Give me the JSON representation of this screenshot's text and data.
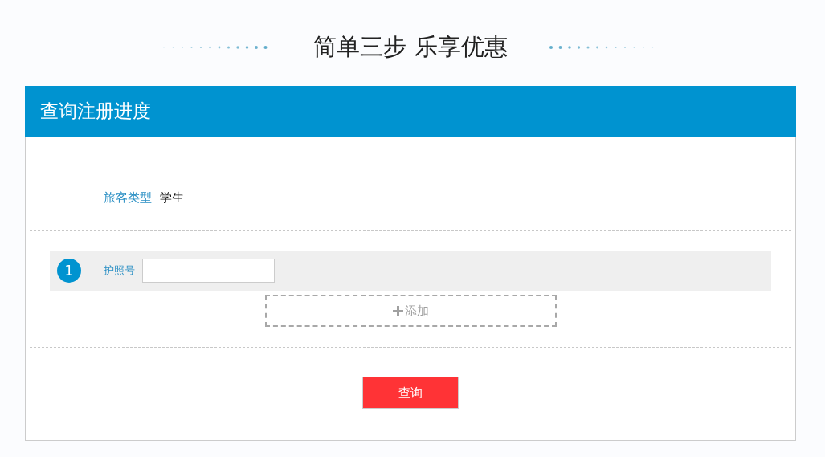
{
  "heading": "简单三步 乐享优惠",
  "panel": {
    "title": "查询注册进度"
  },
  "passenger_type": {
    "label": "旅客类型",
    "value": "学生"
  },
  "passengers": [
    {
      "number": "1",
      "label": "护照号"
    }
  ],
  "add_button": "添加",
  "query_button": "查询"
}
